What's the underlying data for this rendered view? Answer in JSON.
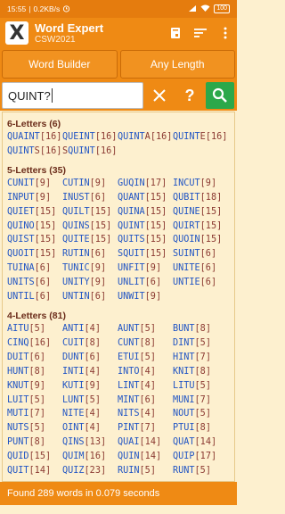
{
  "status": {
    "time": "15:55",
    "speed": "0.2KB/s",
    "battery": "100"
  },
  "app": {
    "title": "Word Expert",
    "subtitle": "CSW2021",
    "logo": "X"
  },
  "modes": {
    "builder": "Word Builder",
    "length": "Any Length"
  },
  "search": {
    "value": "QUINT?"
  },
  "groups": [
    {
      "heading": "6-Letters (6)",
      "words": [
        {
          "pre": "QUAINT",
          "blank": "",
          "post": "",
          "score": "[16]"
        },
        {
          "pre": "QUEINT",
          "blank": "",
          "post": "",
          "score": "[16]"
        },
        {
          "pre": "QUINT",
          "blank": "A",
          "post": "",
          "score": "[16]"
        },
        {
          "pre": "QUINT",
          "blank": "E",
          "post": "",
          "score": "[16]"
        },
        {
          "pre": "QUINT",
          "blank": "S",
          "post": "",
          "score": "[16]"
        },
        {
          "pre": "",
          "blank": "S",
          "post": "QUINT",
          "score": "[16]"
        }
      ]
    },
    {
      "heading": "5-Letters (35)",
      "words": [
        {
          "pre": "CUNIT",
          "blank": "",
          "post": "",
          "score": "[9]"
        },
        {
          "pre": "CUTIN",
          "blank": "",
          "post": "",
          "score": "[9]"
        },
        {
          "pre": "GUQIN",
          "blank": "",
          "post": "",
          "score": "[17]"
        },
        {
          "pre": "INCUT",
          "blank": "",
          "post": "",
          "score": "[9]"
        },
        {
          "pre": "INPUT",
          "blank": "",
          "post": "",
          "score": "[9]"
        },
        {
          "pre": "INUST",
          "blank": "",
          "post": "",
          "score": "[6]"
        },
        {
          "pre": "QUANT",
          "blank": "",
          "post": "",
          "score": "[15]"
        },
        {
          "pre": "QUBIT",
          "blank": "",
          "post": "",
          "score": "[18]"
        },
        {
          "pre": "QUIET",
          "blank": "",
          "post": "",
          "score": "[15]"
        },
        {
          "pre": "QUILT",
          "blank": "",
          "post": "",
          "score": "[15]"
        },
        {
          "pre": "QUINA",
          "blank": "",
          "post": "",
          "score": "[15]"
        },
        {
          "pre": "QUINE",
          "blank": "",
          "post": "",
          "score": "[15]"
        },
        {
          "pre": "QUINO",
          "blank": "",
          "post": "",
          "score": "[15]"
        },
        {
          "pre": "QUINS",
          "blank": "",
          "post": "",
          "score": "[15]"
        },
        {
          "pre": "QUINT",
          "blank": "",
          "post": "",
          "score": "[15]"
        },
        {
          "pre": "QUIRT",
          "blank": "",
          "post": "",
          "score": "[15]"
        },
        {
          "pre": "QUIST",
          "blank": "",
          "post": "",
          "score": "[15]"
        },
        {
          "pre": "QUITE",
          "blank": "",
          "post": "",
          "score": "[15]"
        },
        {
          "pre": "QUITS",
          "blank": "",
          "post": "",
          "score": "[15]"
        },
        {
          "pre": "QUOIN",
          "blank": "",
          "post": "",
          "score": "[15]"
        },
        {
          "pre": "QUOIT",
          "blank": "",
          "post": "",
          "score": "[15]"
        },
        {
          "pre": "RUTIN",
          "blank": "",
          "post": "",
          "score": "[6]"
        },
        {
          "pre": "SQUIT",
          "blank": "",
          "post": "",
          "score": "[15]"
        },
        {
          "pre": "SUINT",
          "blank": "",
          "post": "",
          "score": "[6]"
        },
        {
          "pre": "TUINA",
          "blank": "",
          "post": "",
          "score": "[6]"
        },
        {
          "pre": "TUNIC",
          "blank": "",
          "post": "",
          "score": "[9]"
        },
        {
          "pre": "UNFIT",
          "blank": "",
          "post": "",
          "score": "[9]"
        },
        {
          "pre": "UNITE",
          "blank": "",
          "post": "",
          "score": "[6]"
        },
        {
          "pre": "UNITS",
          "blank": "",
          "post": "",
          "score": "[6]"
        },
        {
          "pre": "UNITY",
          "blank": "",
          "post": "",
          "score": "[9]"
        },
        {
          "pre": "UNLIT",
          "blank": "",
          "post": "",
          "score": "[6]"
        },
        {
          "pre": "UNTIE",
          "blank": "",
          "post": "",
          "score": "[6]"
        },
        {
          "pre": "UNTIL",
          "blank": "",
          "post": "",
          "score": "[6]"
        },
        {
          "pre": "UNTIN",
          "blank": "",
          "post": "",
          "score": "[6]"
        },
        {
          "pre": "UNWIT",
          "blank": "",
          "post": "",
          "score": "[9]"
        }
      ]
    },
    {
      "heading": "4-Letters (81)",
      "words": [
        {
          "pre": "AITU",
          "blank": "",
          "post": "",
          "score": "[5]"
        },
        {
          "pre": "ANTI",
          "blank": "",
          "post": "",
          "score": "[4]"
        },
        {
          "pre": "AUNT",
          "blank": "",
          "post": "",
          "score": "[5]"
        },
        {
          "pre": "BUNT",
          "blank": "",
          "post": "",
          "score": "[8]"
        },
        {
          "pre": "CINQ",
          "blank": "",
          "post": "",
          "score": "[16]"
        },
        {
          "pre": "CUIT",
          "blank": "",
          "post": "",
          "score": "[8]"
        },
        {
          "pre": "CUNT",
          "blank": "",
          "post": "",
          "score": "[8]"
        },
        {
          "pre": "DINT",
          "blank": "",
          "post": "",
          "score": "[5]"
        },
        {
          "pre": "DUIT",
          "blank": "",
          "post": "",
          "score": "[6]"
        },
        {
          "pre": "DUNT",
          "blank": "",
          "post": "",
          "score": "[6]"
        },
        {
          "pre": "ETUI",
          "blank": "",
          "post": "",
          "score": "[5]"
        },
        {
          "pre": "HINT",
          "blank": "",
          "post": "",
          "score": "[7]"
        },
        {
          "pre": "HUNT",
          "blank": "",
          "post": "",
          "score": "[8]"
        },
        {
          "pre": "INTI",
          "blank": "",
          "post": "",
          "score": "[4]"
        },
        {
          "pre": "INTO",
          "blank": "",
          "post": "",
          "score": "[4]"
        },
        {
          "pre": "KNIT",
          "blank": "",
          "post": "",
          "score": "[8]"
        },
        {
          "pre": "KNUT",
          "blank": "",
          "post": "",
          "score": "[9]"
        },
        {
          "pre": "KUTI",
          "blank": "",
          "post": "",
          "score": "[9]"
        },
        {
          "pre": "LINT",
          "blank": "",
          "post": "",
          "score": "[4]"
        },
        {
          "pre": "LITU",
          "blank": "",
          "post": "",
          "score": "[5]"
        },
        {
          "pre": "LUIT",
          "blank": "",
          "post": "",
          "score": "[5]"
        },
        {
          "pre": "LUNT",
          "blank": "",
          "post": "",
          "score": "[5]"
        },
        {
          "pre": "MINT",
          "blank": "",
          "post": "",
          "score": "[6]"
        },
        {
          "pre": "MUNI",
          "blank": "",
          "post": "",
          "score": "[7]"
        },
        {
          "pre": "MUTI",
          "blank": "",
          "post": "",
          "score": "[7]"
        },
        {
          "pre": "NITE",
          "blank": "",
          "post": "",
          "score": "[4]"
        },
        {
          "pre": "NITS",
          "blank": "",
          "post": "",
          "score": "[4]"
        },
        {
          "pre": "NOUT",
          "blank": "",
          "post": "",
          "score": "[5]"
        },
        {
          "pre": "NUTS",
          "blank": "",
          "post": "",
          "score": "[5]"
        },
        {
          "pre": "OINT",
          "blank": "",
          "post": "",
          "score": "[4]"
        },
        {
          "pre": "PINT",
          "blank": "",
          "post": "",
          "score": "[7]"
        },
        {
          "pre": "PTUI",
          "blank": "",
          "post": "",
          "score": "[8]"
        },
        {
          "pre": "PUNT",
          "blank": "",
          "post": "",
          "score": "[8]"
        },
        {
          "pre": "QINS",
          "blank": "",
          "post": "",
          "score": "[13]"
        },
        {
          "pre": "QUAI",
          "blank": "",
          "post": "",
          "score": "[14]"
        },
        {
          "pre": "QUAT",
          "blank": "",
          "post": "",
          "score": "[14]"
        },
        {
          "pre": "QUID",
          "blank": "",
          "post": "",
          "score": "[15]"
        },
        {
          "pre": "QUIM",
          "blank": "",
          "post": "",
          "score": "[16]"
        },
        {
          "pre": "QUIN",
          "blank": "",
          "post": "",
          "score": "[14]"
        },
        {
          "pre": "QUIP",
          "blank": "",
          "post": "",
          "score": "[17]"
        },
        {
          "pre": "QUIT",
          "blank": "",
          "post": "",
          "score": "[14]"
        },
        {
          "pre": "QUIZ",
          "blank": "",
          "post": "",
          "score": "[23]"
        },
        {
          "pre": "RUIN",
          "blank": "",
          "post": "",
          "score": "[5]"
        },
        {
          "pre": "RUNT",
          "blank": "",
          "post": "",
          "score": "[5]"
        }
      ]
    }
  ],
  "footer": {
    "text": "Found 289 words in 0.079 seconds"
  }
}
